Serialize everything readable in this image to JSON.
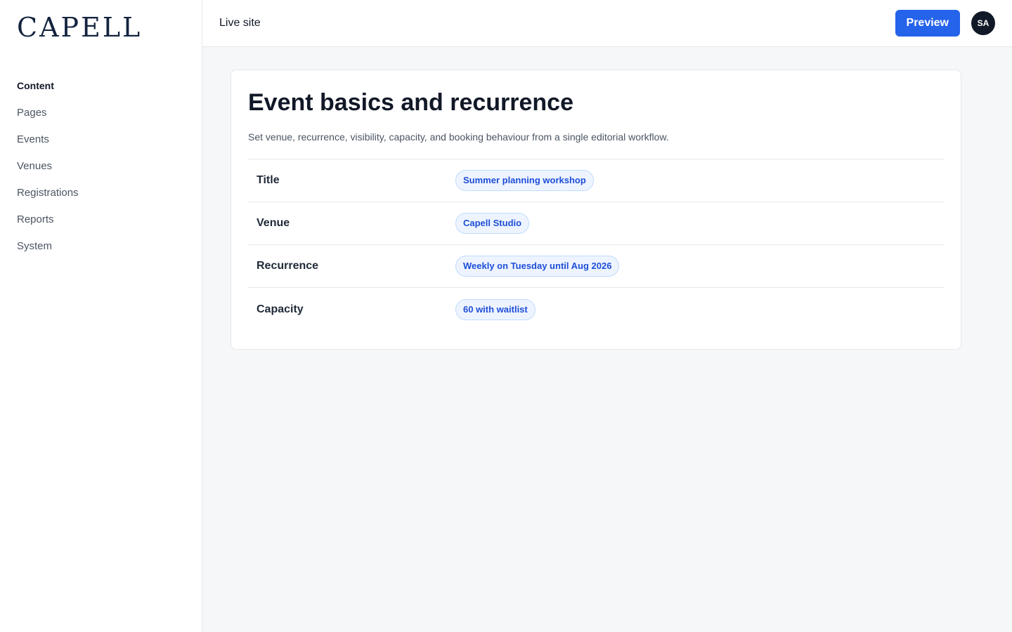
{
  "brand": {
    "logo": "CAPELL"
  },
  "sidebar": {
    "heading": "Content",
    "items": [
      {
        "label": "Pages"
      },
      {
        "label": "Events"
      },
      {
        "label": "Venues"
      },
      {
        "label": "Registrations"
      },
      {
        "label": "Reports"
      },
      {
        "label": "System"
      }
    ]
  },
  "header": {
    "live_site": "Live site",
    "preview_label": "Preview",
    "avatar_initials": "SA"
  },
  "card": {
    "title": "Event basics and recurrence",
    "description": "Set venue, recurrence, visibility, capacity, and booking behaviour from a single editorial workflow.",
    "fields": [
      {
        "label": "Title",
        "value": "Summer planning workshop"
      },
      {
        "label": "Venue",
        "value": "Capell Studio"
      },
      {
        "label": "Recurrence",
        "value": "Weekly on Tuesday until Aug 2026"
      },
      {
        "label": "Capacity",
        "value": "60 with waitlist"
      }
    ]
  },
  "colors": {
    "accent": "#2563eb",
    "chip_text": "#1d4ed8",
    "chip_bg": "#eef4ff",
    "logo": "#13233f"
  }
}
